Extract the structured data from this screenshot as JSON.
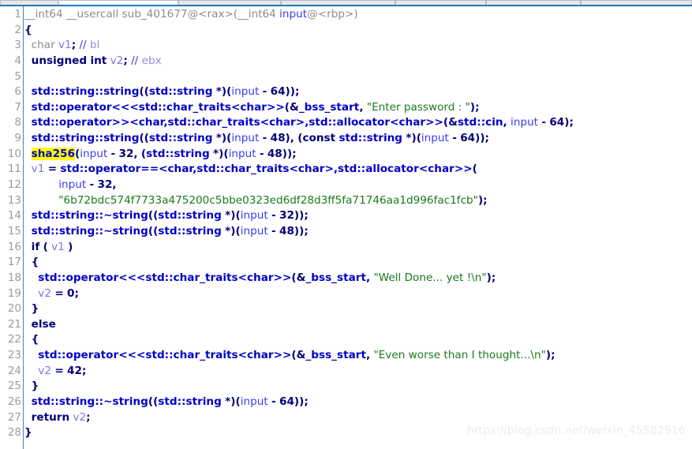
{
  "window": {
    "tabs": [
      {
        "label": "",
        "active": false,
        "width": 74
      },
      {
        "label": "",
        "active": true,
        "width": 152
      },
      {
        "label": "",
        "active": false,
        "width": 130
      },
      {
        "label": "",
        "active": false,
        "width": 145
      },
      {
        "label": "",
        "active": false,
        "width": 115
      },
      {
        "label": "",
        "active": false,
        "width": 120
      },
      {
        "label": "",
        "active": false,
        "width": 141
      }
    ]
  },
  "editor": {
    "function_name": "sub_401677",
    "highlighted_token": "sha256",
    "cursor_line": 10,
    "colors": {
      "background": "#ffffff",
      "line_number": "#9b9b9b",
      "gutter_separator": "#3f86c4",
      "plain_text": "#8d8d8d",
      "function_name": "#0000c8",
      "keyword": "#00007a",
      "local_variable": "#7878e6",
      "argument": "#3c3cf0",
      "string_literal": "#1b7a1b",
      "number": "#00007a",
      "comment": "#3c3cf0",
      "register_comment": "#8f8fe0",
      "selection_highlight": "#ffff00",
      "tab_active": "#ffffff",
      "tab_inactive": "#e8e8e8",
      "tab_underline": "#2279bd"
    },
    "line_numbers": [
      1,
      2,
      3,
      4,
      5,
      6,
      7,
      8,
      9,
      10,
      11,
      12,
      13,
      14,
      15,
      16,
      17,
      18,
      19,
      20,
      21,
      22,
      23,
      24,
      25,
      26,
      27,
      28
    ],
    "lines": [
      {
        "n": 1,
        "text": "__int64 __usercall sub_401677@<rax>(__int64 input@<rbp>)"
      },
      {
        "n": 2,
        "text": "{"
      },
      {
        "n": 3,
        "text": "  char v1; // bl"
      },
      {
        "n": 4,
        "text": "  unsigned int v2; // ebx"
      },
      {
        "n": 5,
        "text": ""
      },
      {
        "n": 6,
        "text": "  std::string::string((std::string *)(input - 64));"
      },
      {
        "n": 7,
        "text": "  std::operator<<<std::char_traits<char>>(&_bss_start, \"Enter password : \");"
      },
      {
        "n": 8,
        "text": "  std::operator>><char,std::char_traits<char>,std::allocator<char>>(&std::cin, input - 64);"
      },
      {
        "n": 9,
        "text": "  std::string::string((std::string *)(input - 48), (const std::string *)(input - 64));"
      },
      {
        "n": 10,
        "text": "  sha256(input - 32, (std::string *)(input - 48));"
      },
      {
        "n": 11,
        "text": "  v1 = std::operator==<char,std::char_traits<char>,std::allocator<char>>("
      },
      {
        "n": 12,
        "text": "          input - 32,"
      },
      {
        "n": 13,
        "text": "          \"6b72bdc574f7733a475200c5bbe0323ed6df28d3ff5fa71746aa1d996fac1fcb\");"
      },
      {
        "n": 14,
        "text": "  std::string::~string((std::string *)(input - 32));"
      },
      {
        "n": 15,
        "text": "  std::string::~string((std::string *)(input - 48));"
      },
      {
        "n": 16,
        "text": "  if ( v1 )"
      },
      {
        "n": 17,
        "text": "  {"
      },
      {
        "n": 18,
        "text": "    std::operator<<<std::char_traits<char>>(&_bss_start, \"Well Done... yet !\\n\");"
      },
      {
        "n": 19,
        "text": "    v2 = 0;"
      },
      {
        "n": 20,
        "text": "  }"
      },
      {
        "n": 21,
        "text": "  else"
      },
      {
        "n": 22,
        "text": "  {"
      },
      {
        "n": 23,
        "text": "    std::operator<<<std::char_traits<char>>(&_bss_start, \"Even worse than I thought...\\n\");"
      },
      {
        "n": 24,
        "text": "    v2 = 42;"
      },
      {
        "n": 25,
        "text": "  }"
      },
      {
        "n": 26,
        "text": "  std::string::~string((std::string *)(input - 64));"
      },
      {
        "n": 27,
        "text": "  return v2;"
      },
      {
        "n": 28,
        "text": "}"
      }
    ],
    "strings": [
      "Enter password : ",
      "6b72bdc574f7733a475200c5bbe0323ed6df28d3ff5fa71746aa1d996fac1fcb",
      "Well Done... yet !\\n",
      "Even worse than I thought...\\n"
    ],
    "variables": [
      "v1",
      "v2",
      "input"
    ],
    "registers": [
      "bl",
      "ebx",
      "rax",
      "rbp"
    ],
    "return_values": [
      "0",
      "42"
    ],
    "offsets": [
      "64",
      "48",
      "32"
    ]
  },
  "watermark": {
    "text": "https://blog.csdn.net/weixin_45582916"
  }
}
